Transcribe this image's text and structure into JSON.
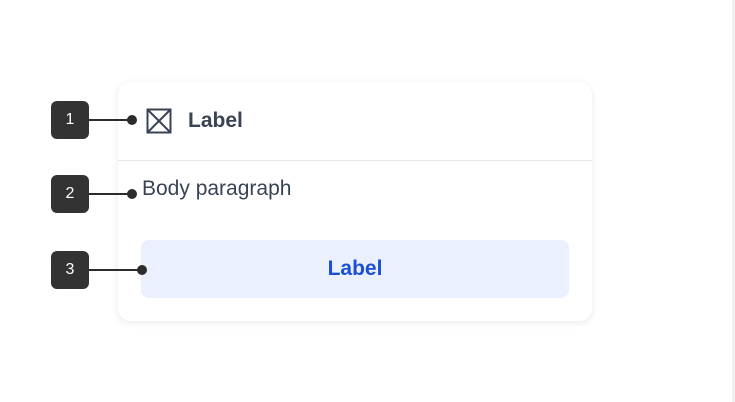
{
  "card": {
    "header_label": "Label",
    "header_icon": "placeholder-image-icon",
    "body_text": "Body paragraph",
    "button_label": "Label"
  },
  "annotations": [
    {
      "number": "1",
      "target": "card-header"
    },
    {
      "number": "2",
      "target": "card-body"
    },
    {
      "number": "3",
      "target": "card-button"
    }
  ],
  "colors": {
    "marker_bg": "#333333",
    "text": "#3a4354",
    "button_bg": "#eaf0fd",
    "button_text": "#1a4fd6",
    "divider": "#e4e6ea"
  }
}
